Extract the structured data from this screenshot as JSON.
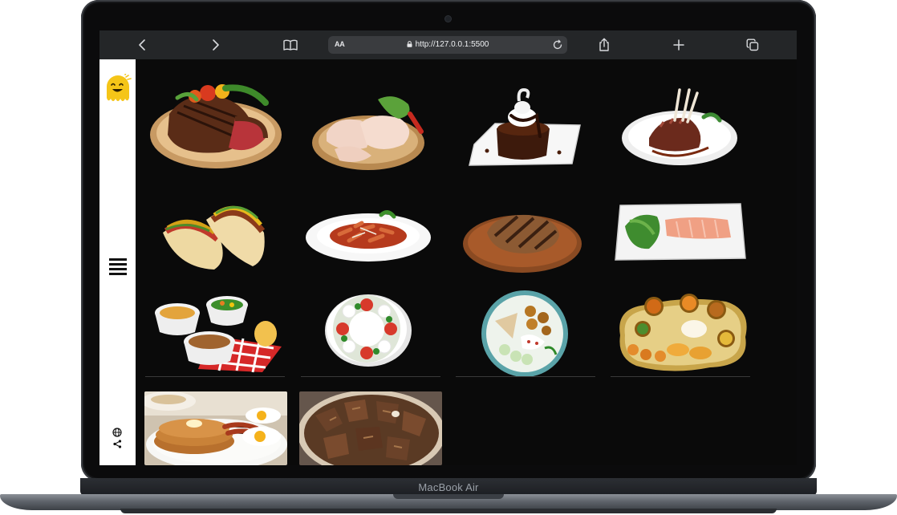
{
  "device": {
    "model_label": "MacBook Air"
  },
  "browser": {
    "text_size_label": "AA",
    "url": "http://127.0.0.1:5500",
    "icons": [
      "back-chevron-icon",
      "forward-chevron-icon",
      "reader-book-icon",
      "lock-icon",
      "reload-icon",
      "share-icon",
      "new-tab-plus-icon",
      "tabs-icon"
    ]
  },
  "sidebar": {
    "icons": [
      "smiley-logo-icon",
      "hamburger-menu-icon",
      "globe-icon",
      "share-nodes-icon"
    ],
    "accent_color": "#f5c518"
  },
  "gallery": {
    "items": [
      {
        "dish": "steak-plate-icon"
      },
      {
        "dish": "chicken-legs-icon"
      },
      {
        "dish": "chocolate-cake-icon"
      },
      {
        "dish": "lamb-chops-icon"
      },
      {
        "dish": "tacos-icon"
      },
      {
        "dish": "penne-pasta-icon"
      },
      {
        "dish": "grilled-pork-chop-icon"
      },
      {
        "dish": "salmon-plate-icon"
      },
      {
        "dish": "side-dishes-icon"
      },
      {
        "dish": "caprese-salad-icon"
      },
      {
        "dish": "mediterranean-bowl-icon"
      },
      {
        "dish": "thali-platter-icon"
      },
      {
        "dish": "pancakes-breakfast-icon"
      },
      {
        "dish": "beef-stew-icon"
      }
    ]
  }
}
